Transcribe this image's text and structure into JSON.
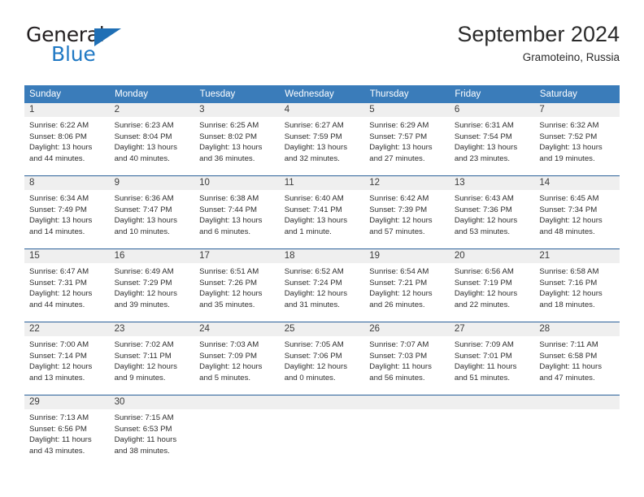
{
  "brand": {
    "name_top": "General",
    "name_bottom": "Blue",
    "accent_color": "#2079c4",
    "triangle_color": "#1f6fb5"
  },
  "header": {
    "title": "September 2024",
    "location": "Gramoteino, Russia"
  },
  "calendar": {
    "header_bg": "#3a7cba",
    "header_text_color": "#ffffff",
    "daynum_bg": "#efefef",
    "row_border_color": "#2a6099",
    "weekdays": [
      "Sunday",
      "Monday",
      "Tuesday",
      "Wednesday",
      "Thursday",
      "Friday",
      "Saturday"
    ],
    "labels": {
      "sunrise": "Sunrise:",
      "sunset": "Sunset:",
      "daylight": "Daylight:"
    },
    "weeks": [
      [
        {
          "day": "1",
          "sunrise": "Sunrise: 6:22 AM",
          "sunset": "Sunset: 8:06 PM",
          "daylight_line1": "Daylight: 13 hours",
          "daylight_line2": "and 44 minutes."
        },
        {
          "day": "2",
          "sunrise": "Sunrise: 6:23 AM",
          "sunset": "Sunset: 8:04 PM",
          "daylight_line1": "Daylight: 13 hours",
          "daylight_line2": "and 40 minutes."
        },
        {
          "day": "3",
          "sunrise": "Sunrise: 6:25 AM",
          "sunset": "Sunset: 8:02 PM",
          "daylight_line1": "Daylight: 13 hours",
          "daylight_line2": "and 36 minutes."
        },
        {
          "day": "4",
          "sunrise": "Sunrise: 6:27 AM",
          "sunset": "Sunset: 7:59 PM",
          "daylight_line1": "Daylight: 13 hours",
          "daylight_line2": "and 32 minutes."
        },
        {
          "day": "5",
          "sunrise": "Sunrise: 6:29 AM",
          "sunset": "Sunset: 7:57 PM",
          "daylight_line1": "Daylight: 13 hours",
          "daylight_line2": "and 27 minutes."
        },
        {
          "day": "6",
          "sunrise": "Sunrise: 6:31 AM",
          "sunset": "Sunset: 7:54 PM",
          "daylight_line1": "Daylight: 13 hours",
          "daylight_line2": "and 23 minutes."
        },
        {
          "day": "7",
          "sunrise": "Sunrise: 6:32 AM",
          "sunset": "Sunset: 7:52 PM",
          "daylight_line1": "Daylight: 13 hours",
          "daylight_line2": "and 19 minutes."
        }
      ],
      [
        {
          "day": "8",
          "sunrise": "Sunrise: 6:34 AM",
          "sunset": "Sunset: 7:49 PM",
          "daylight_line1": "Daylight: 13 hours",
          "daylight_line2": "and 14 minutes."
        },
        {
          "day": "9",
          "sunrise": "Sunrise: 6:36 AM",
          "sunset": "Sunset: 7:47 PM",
          "daylight_line1": "Daylight: 13 hours",
          "daylight_line2": "and 10 minutes."
        },
        {
          "day": "10",
          "sunrise": "Sunrise: 6:38 AM",
          "sunset": "Sunset: 7:44 PM",
          "daylight_line1": "Daylight: 13 hours",
          "daylight_line2": "and 6 minutes."
        },
        {
          "day": "11",
          "sunrise": "Sunrise: 6:40 AM",
          "sunset": "Sunset: 7:41 PM",
          "daylight_line1": "Daylight: 13 hours",
          "daylight_line2": "and 1 minute."
        },
        {
          "day": "12",
          "sunrise": "Sunrise: 6:42 AM",
          "sunset": "Sunset: 7:39 PM",
          "daylight_line1": "Daylight: 12 hours",
          "daylight_line2": "and 57 minutes."
        },
        {
          "day": "13",
          "sunrise": "Sunrise: 6:43 AM",
          "sunset": "Sunset: 7:36 PM",
          "daylight_line1": "Daylight: 12 hours",
          "daylight_line2": "and 53 minutes."
        },
        {
          "day": "14",
          "sunrise": "Sunrise: 6:45 AM",
          "sunset": "Sunset: 7:34 PM",
          "daylight_line1": "Daylight: 12 hours",
          "daylight_line2": "and 48 minutes."
        }
      ],
      [
        {
          "day": "15",
          "sunrise": "Sunrise: 6:47 AM",
          "sunset": "Sunset: 7:31 PM",
          "daylight_line1": "Daylight: 12 hours",
          "daylight_line2": "and 44 minutes."
        },
        {
          "day": "16",
          "sunrise": "Sunrise: 6:49 AM",
          "sunset": "Sunset: 7:29 PM",
          "daylight_line1": "Daylight: 12 hours",
          "daylight_line2": "and 39 minutes."
        },
        {
          "day": "17",
          "sunrise": "Sunrise: 6:51 AM",
          "sunset": "Sunset: 7:26 PM",
          "daylight_line1": "Daylight: 12 hours",
          "daylight_line2": "and 35 minutes."
        },
        {
          "day": "18",
          "sunrise": "Sunrise: 6:52 AM",
          "sunset": "Sunset: 7:24 PM",
          "daylight_line1": "Daylight: 12 hours",
          "daylight_line2": "and 31 minutes."
        },
        {
          "day": "19",
          "sunrise": "Sunrise: 6:54 AM",
          "sunset": "Sunset: 7:21 PM",
          "daylight_line1": "Daylight: 12 hours",
          "daylight_line2": "and 26 minutes."
        },
        {
          "day": "20",
          "sunrise": "Sunrise: 6:56 AM",
          "sunset": "Sunset: 7:19 PM",
          "daylight_line1": "Daylight: 12 hours",
          "daylight_line2": "and 22 minutes."
        },
        {
          "day": "21",
          "sunrise": "Sunrise: 6:58 AM",
          "sunset": "Sunset: 7:16 PM",
          "daylight_line1": "Daylight: 12 hours",
          "daylight_line2": "and 18 minutes."
        }
      ],
      [
        {
          "day": "22",
          "sunrise": "Sunrise: 7:00 AM",
          "sunset": "Sunset: 7:14 PM",
          "daylight_line1": "Daylight: 12 hours",
          "daylight_line2": "and 13 minutes."
        },
        {
          "day": "23",
          "sunrise": "Sunrise: 7:02 AM",
          "sunset": "Sunset: 7:11 PM",
          "daylight_line1": "Daylight: 12 hours",
          "daylight_line2": "and 9 minutes."
        },
        {
          "day": "24",
          "sunrise": "Sunrise: 7:03 AM",
          "sunset": "Sunset: 7:09 PM",
          "daylight_line1": "Daylight: 12 hours",
          "daylight_line2": "and 5 minutes."
        },
        {
          "day": "25",
          "sunrise": "Sunrise: 7:05 AM",
          "sunset": "Sunset: 7:06 PM",
          "daylight_line1": "Daylight: 12 hours",
          "daylight_line2": "and 0 minutes."
        },
        {
          "day": "26",
          "sunrise": "Sunrise: 7:07 AM",
          "sunset": "Sunset: 7:03 PM",
          "daylight_line1": "Daylight: 11 hours",
          "daylight_line2": "and 56 minutes."
        },
        {
          "day": "27",
          "sunrise": "Sunrise: 7:09 AM",
          "sunset": "Sunset: 7:01 PM",
          "daylight_line1": "Daylight: 11 hours",
          "daylight_line2": "and 51 minutes."
        },
        {
          "day": "28",
          "sunrise": "Sunrise: 7:11 AM",
          "sunset": "Sunset: 6:58 PM",
          "daylight_line1": "Daylight: 11 hours",
          "daylight_line2": "and 47 minutes."
        }
      ],
      [
        {
          "day": "29",
          "sunrise": "Sunrise: 7:13 AM",
          "sunset": "Sunset: 6:56 PM",
          "daylight_line1": "Daylight: 11 hours",
          "daylight_line2": "and 43 minutes."
        },
        {
          "day": "30",
          "sunrise": "Sunrise: 7:15 AM",
          "sunset": "Sunset: 6:53 PM",
          "daylight_line1": "Daylight: 11 hours",
          "daylight_line2": "and 38 minutes."
        },
        {
          "day": "",
          "sunrise": "",
          "sunset": "",
          "daylight_line1": "",
          "daylight_line2": ""
        },
        {
          "day": "",
          "sunrise": "",
          "sunset": "",
          "daylight_line1": "",
          "daylight_line2": ""
        },
        {
          "day": "",
          "sunrise": "",
          "sunset": "",
          "daylight_line1": "",
          "daylight_line2": ""
        },
        {
          "day": "",
          "sunrise": "",
          "sunset": "",
          "daylight_line1": "",
          "daylight_line2": ""
        },
        {
          "day": "",
          "sunrise": "",
          "sunset": "",
          "daylight_line1": "",
          "daylight_line2": ""
        }
      ]
    ]
  }
}
